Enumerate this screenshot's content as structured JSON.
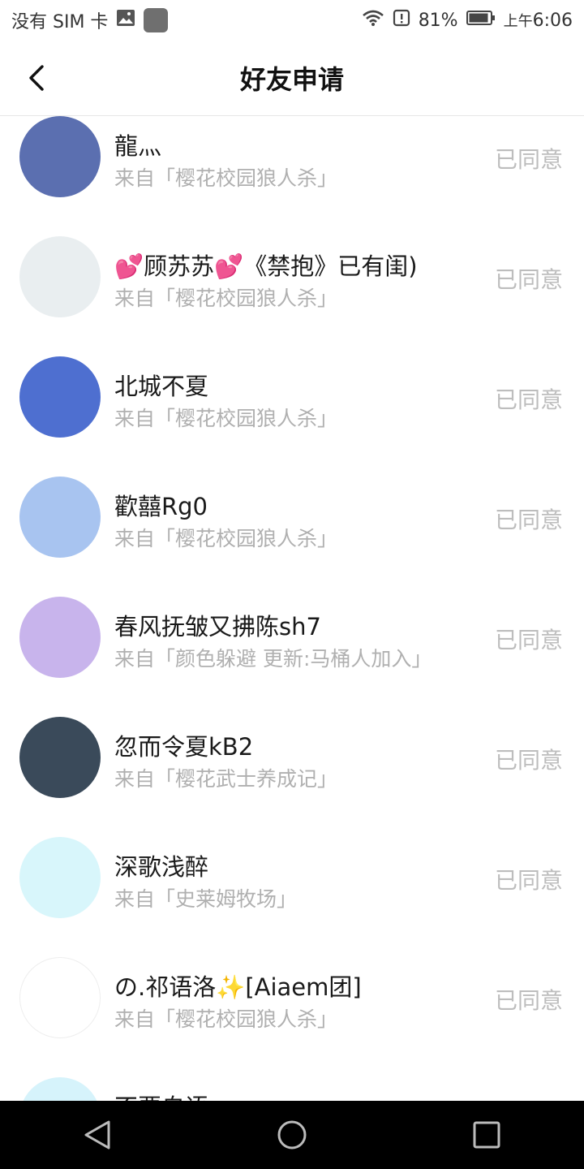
{
  "statusbar": {
    "carrier": "没有 SIM 卡",
    "battery": "81%",
    "ampm": "上午",
    "time": "6:06"
  },
  "header": {
    "title": "好友申请"
  },
  "requests": [
    {
      "name": "龍灬",
      "source": "来自「樱花校园狼人杀」",
      "status": "已同意",
      "avatar_color": "#5b6fb0"
    },
    {
      "name": "💕顾苏苏💕《禁抱》已有闺)",
      "source": "来自「樱花校园狼人杀」",
      "status": "已同意",
      "avatar_color": "#e9eef0"
    },
    {
      "name": "北城不夏",
      "source": "来自「樱花校园狼人杀」",
      "status": "已同意",
      "avatar_color": "#4e6fd0"
    },
    {
      "name": "歡囍Rg0",
      "source": "来自「樱花校园狼人杀」",
      "status": "已同意",
      "avatar_color": "#a8c4f0"
    },
    {
      "name": "春风抚皱又拂陈sh7",
      "source": "来自「颜色躲避 更新:马桶人加入」",
      "status": "已同意",
      "avatar_color": "#c8b4ec"
    },
    {
      "name": "忽而令夏kB2",
      "source": "来自「樱花武士养成记」",
      "status": "已同意",
      "avatar_color": "#3a4a5a"
    },
    {
      "name": "深歌浅醉",
      "source": "来自「史莱姆牧场」",
      "status": "已同意",
      "avatar_color": "#d8f6fb"
    },
    {
      "name": "の.祁语洛✨[Aiaem团]",
      "source": "来自「樱花校园狼人杀」",
      "status": "已同意",
      "avatar_color": "#ffffff"
    },
    {
      "name": "不要自语",
      "source": "",
      "status": "",
      "avatar_color": "#d6f3fb"
    }
  ]
}
